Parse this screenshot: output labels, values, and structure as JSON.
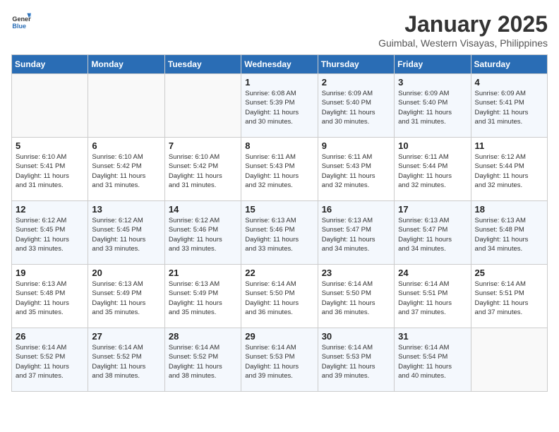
{
  "header": {
    "logo_general": "General",
    "logo_blue": "Blue",
    "title": "January 2025",
    "subtitle": "Guimbal, Western Visayas, Philippines"
  },
  "days_of_week": [
    "Sunday",
    "Monday",
    "Tuesday",
    "Wednesday",
    "Thursday",
    "Friday",
    "Saturday"
  ],
  "weeks": [
    [
      {
        "day": "",
        "info": ""
      },
      {
        "day": "",
        "info": ""
      },
      {
        "day": "",
        "info": ""
      },
      {
        "day": "1",
        "info": "Sunrise: 6:08 AM\nSunset: 5:39 PM\nDaylight: 11 hours\nand 30 minutes."
      },
      {
        "day": "2",
        "info": "Sunrise: 6:09 AM\nSunset: 5:40 PM\nDaylight: 11 hours\nand 30 minutes."
      },
      {
        "day": "3",
        "info": "Sunrise: 6:09 AM\nSunset: 5:40 PM\nDaylight: 11 hours\nand 31 minutes."
      },
      {
        "day": "4",
        "info": "Sunrise: 6:09 AM\nSunset: 5:41 PM\nDaylight: 11 hours\nand 31 minutes."
      }
    ],
    [
      {
        "day": "5",
        "info": "Sunrise: 6:10 AM\nSunset: 5:41 PM\nDaylight: 11 hours\nand 31 minutes."
      },
      {
        "day": "6",
        "info": "Sunrise: 6:10 AM\nSunset: 5:42 PM\nDaylight: 11 hours\nand 31 minutes."
      },
      {
        "day": "7",
        "info": "Sunrise: 6:10 AM\nSunset: 5:42 PM\nDaylight: 11 hours\nand 31 minutes."
      },
      {
        "day": "8",
        "info": "Sunrise: 6:11 AM\nSunset: 5:43 PM\nDaylight: 11 hours\nand 32 minutes."
      },
      {
        "day": "9",
        "info": "Sunrise: 6:11 AM\nSunset: 5:43 PM\nDaylight: 11 hours\nand 32 minutes."
      },
      {
        "day": "10",
        "info": "Sunrise: 6:11 AM\nSunset: 5:44 PM\nDaylight: 11 hours\nand 32 minutes."
      },
      {
        "day": "11",
        "info": "Sunrise: 6:12 AM\nSunset: 5:44 PM\nDaylight: 11 hours\nand 32 minutes."
      }
    ],
    [
      {
        "day": "12",
        "info": "Sunrise: 6:12 AM\nSunset: 5:45 PM\nDaylight: 11 hours\nand 33 minutes."
      },
      {
        "day": "13",
        "info": "Sunrise: 6:12 AM\nSunset: 5:45 PM\nDaylight: 11 hours\nand 33 minutes."
      },
      {
        "day": "14",
        "info": "Sunrise: 6:12 AM\nSunset: 5:46 PM\nDaylight: 11 hours\nand 33 minutes."
      },
      {
        "day": "15",
        "info": "Sunrise: 6:13 AM\nSunset: 5:46 PM\nDaylight: 11 hours\nand 33 minutes."
      },
      {
        "day": "16",
        "info": "Sunrise: 6:13 AM\nSunset: 5:47 PM\nDaylight: 11 hours\nand 34 minutes."
      },
      {
        "day": "17",
        "info": "Sunrise: 6:13 AM\nSunset: 5:47 PM\nDaylight: 11 hours\nand 34 minutes."
      },
      {
        "day": "18",
        "info": "Sunrise: 6:13 AM\nSunset: 5:48 PM\nDaylight: 11 hours\nand 34 minutes."
      }
    ],
    [
      {
        "day": "19",
        "info": "Sunrise: 6:13 AM\nSunset: 5:48 PM\nDaylight: 11 hours\nand 35 minutes."
      },
      {
        "day": "20",
        "info": "Sunrise: 6:13 AM\nSunset: 5:49 PM\nDaylight: 11 hours\nand 35 minutes."
      },
      {
        "day": "21",
        "info": "Sunrise: 6:13 AM\nSunset: 5:49 PM\nDaylight: 11 hours\nand 35 minutes."
      },
      {
        "day": "22",
        "info": "Sunrise: 6:14 AM\nSunset: 5:50 PM\nDaylight: 11 hours\nand 36 minutes."
      },
      {
        "day": "23",
        "info": "Sunrise: 6:14 AM\nSunset: 5:50 PM\nDaylight: 11 hours\nand 36 minutes."
      },
      {
        "day": "24",
        "info": "Sunrise: 6:14 AM\nSunset: 5:51 PM\nDaylight: 11 hours\nand 37 minutes."
      },
      {
        "day": "25",
        "info": "Sunrise: 6:14 AM\nSunset: 5:51 PM\nDaylight: 11 hours\nand 37 minutes."
      }
    ],
    [
      {
        "day": "26",
        "info": "Sunrise: 6:14 AM\nSunset: 5:52 PM\nDaylight: 11 hours\nand 37 minutes."
      },
      {
        "day": "27",
        "info": "Sunrise: 6:14 AM\nSunset: 5:52 PM\nDaylight: 11 hours\nand 38 minutes."
      },
      {
        "day": "28",
        "info": "Sunrise: 6:14 AM\nSunset: 5:52 PM\nDaylight: 11 hours\nand 38 minutes."
      },
      {
        "day": "29",
        "info": "Sunrise: 6:14 AM\nSunset: 5:53 PM\nDaylight: 11 hours\nand 39 minutes."
      },
      {
        "day": "30",
        "info": "Sunrise: 6:14 AM\nSunset: 5:53 PM\nDaylight: 11 hours\nand 39 minutes."
      },
      {
        "day": "31",
        "info": "Sunrise: 6:14 AM\nSunset: 5:54 PM\nDaylight: 11 hours\nand 40 minutes."
      },
      {
        "day": "",
        "info": ""
      }
    ]
  ]
}
